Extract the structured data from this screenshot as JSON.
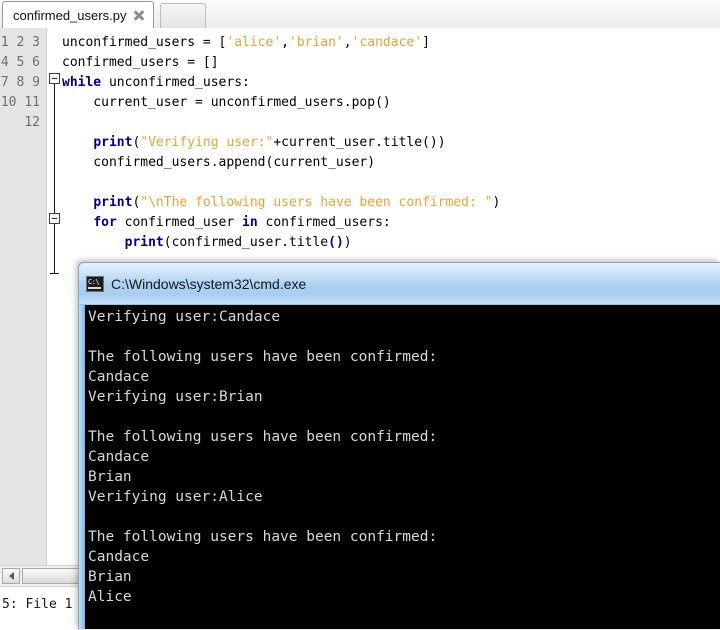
{
  "editor": {
    "tab": {
      "filename": "confirmed_users.py",
      "close_icon": "close-icon"
    },
    "gutter": {
      "line_numbers": "1\n2\n3\n4\n5\n6\n7\n8\n9\n10\n11\n12"
    },
    "code_lines": [
      {
        "number": 1,
        "segments": [
          {
            "text": "unconfirmed_users = [",
            "type": "plain"
          },
          {
            "text": "'alice'",
            "type": "string"
          },
          {
            "text": ",",
            "type": "plain"
          },
          {
            "text": "'brian'",
            "type": "string"
          },
          {
            "text": ",",
            "type": "plain"
          },
          {
            "text": "'candace'",
            "type": "string"
          },
          {
            "text": "]",
            "type": "plain"
          }
        ]
      },
      {
        "number": 2,
        "segments": [
          {
            "text": "confirmed_users = []",
            "type": "plain"
          }
        ]
      },
      {
        "number": 3,
        "segments": [
          {
            "text": "while",
            "type": "keyword"
          },
          {
            "text": " unconfirmed_users:",
            "type": "plain"
          }
        ]
      },
      {
        "number": 4,
        "segments": [
          {
            "text": "    current_user = unconfirmed_users.pop()",
            "type": "plain"
          }
        ]
      },
      {
        "number": 5,
        "segments": []
      },
      {
        "number": 6,
        "segments": [
          {
            "text": "    ",
            "type": "plain"
          },
          {
            "text": "print",
            "type": "keyword"
          },
          {
            "text": "(",
            "type": "plain"
          },
          {
            "text": "\"Verifying user:\"",
            "type": "string"
          },
          {
            "text": "+current_user.title())",
            "type": "plain"
          }
        ]
      },
      {
        "number": 7,
        "segments": [
          {
            "text": "    confirmed_users.append(current_user)",
            "type": "plain"
          }
        ]
      },
      {
        "number": 8,
        "segments": []
      },
      {
        "number": 9,
        "segments": [
          {
            "text": "    ",
            "type": "plain"
          },
          {
            "text": "print",
            "type": "keyword"
          },
          {
            "text": "(",
            "type": "plain"
          },
          {
            "text": "\"\\nThe following users have been confirmed: \"",
            "type": "string"
          },
          {
            "text": ")",
            "type": "plain"
          }
        ]
      },
      {
        "number": 10,
        "segments": [
          {
            "text": "    ",
            "type": "plain"
          },
          {
            "text": "for",
            "type": "keyword"
          },
          {
            "text": " confirmed_user ",
            "type": "plain"
          },
          {
            "text": "in",
            "type": "keyword"
          },
          {
            "text": " confirmed_users:",
            "type": "plain"
          }
        ]
      },
      {
        "number": 11,
        "segments": [
          {
            "text": "        ",
            "type": "plain"
          },
          {
            "text": "print",
            "type": "keyword"
          },
          {
            "text": "(confirmed_user.title",
            "type": "plain"
          },
          {
            "text": "()",
            "type": "keyword"
          },
          {
            "text": ")",
            "type": "plain"
          }
        ]
      },
      {
        "number": 12,
        "segments": []
      }
    ],
    "fold_markers": [
      {
        "line": 3,
        "state": "expanded"
      },
      {
        "line": 10,
        "state": "expanded"
      }
    ],
    "scrollbar": {
      "left_arrow_icon": "chevron-left-icon"
    },
    "status_bar": {
      "text": "5: File 1"
    }
  },
  "console": {
    "title": "C:\\Windows\\system32\\cmd.exe",
    "icon": "cmd-icon",
    "output_lines": [
      "Verifying user:Candace",
      "",
      "The following users have been confirmed:",
      "Candace",
      "Verifying user:Brian",
      "",
      "The following users have been confirmed:",
      "Candace",
      "Brian",
      "Verifying user:Alice",
      "",
      "The following users have been confirmed:",
      "Candace",
      "Brian",
      "Alice"
    ]
  },
  "colors": {
    "keyword": "#000080",
    "string": "#e8a33d",
    "plain_code": "#000000",
    "gutter_bg": "#e4e4e4",
    "console_bg": "#000000",
    "console_fg": "#d8d8d8",
    "titlebar_accent": "#abd0f0"
  }
}
